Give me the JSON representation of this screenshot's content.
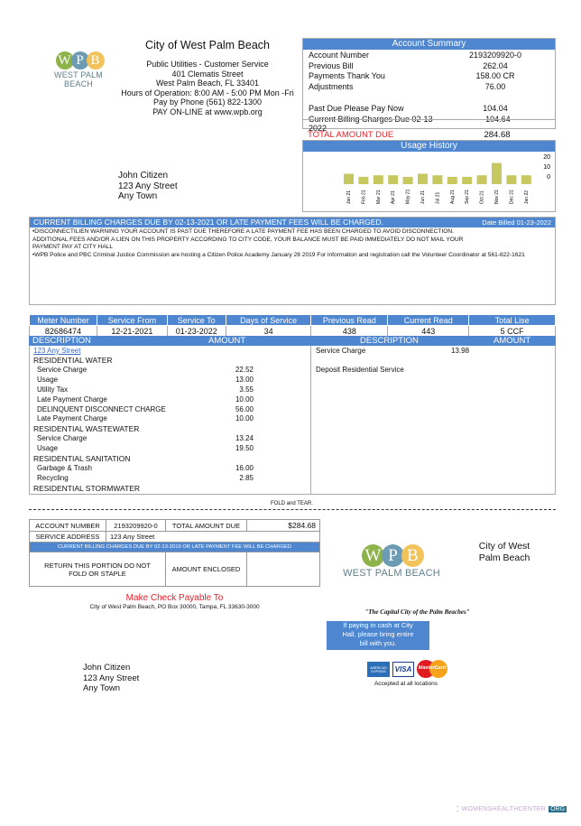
{
  "header": {
    "logo_letters": [
      "W",
      "P",
      "B"
    ],
    "logo_text": "WEST PALM BEACH",
    "title": "City of West Palm Beach",
    "lines": [
      "Public Utilities - Customer Service",
      "401 Clematis Street",
      "West Palm Beach, FL 33401",
      "Hours of Operation: 8:00 AM - 5:00 PM Mon -Fri",
      "Pay by Phone (561) 822-1300",
      "PAY ON-LINE at www.wpb.org"
    ]
  },
  "summary": {
    "title": "Account Summary",
    "rows": [
      {
        "label": "Account Number",
        "value": "2193209920-0"
      },
      {
        "label": "Previous Bill",
        "value": "262.04"
      },
      {
        "label": "Payments Thank You",
        "value": "158.00 CR"
      },
      {
        "label": "Adjustments",
        "value": "76.00"
      },
      {
        "label": "Past Due Please Pay Now",
        "value": "104.04"
      },
      {
        "label": "Current Billing Charges Due 02-13-2022",
        "value": "104.64"
      }
    ],
    "total_label": "TOTAL AMOUNT DUE",
    "total_value": "284.68",
    "total_color": "#e8202a"
  },
  "usage": {
    "title": "Usage History",
    "y_ticks": [
      "20",
      "10",
      "0"
    ],
    "months": [
      "Jan 21",
      "Feb 21",
      "Mar 21",
      "Apr 21",
      "May 21",
      "Jun 21",
      "Jul 21",
      "Aug 21",
      "Sep 21",
      "Oct 21",
      "Nov 21",
      "Dec 21",
      "Jan 22"
    ],
    "values": [
      5,
      3,
      4,
      4,
      3,
      5,
      4,
      3,
      3,
      4,
      12,
      4,
      4
    ],
    "bar_color": "#c8c860"
  },
  "customer": {
    "name": "John Citizen",
    "street": "123 Any Street",
    "town": "Any Town"
  },
  "notice": {
    "title": "CURRENT BILLING CHARGES DUE BY 02-13-2021 OR LATE PAYMENT FEES WILL BE CHARGED.",
    "date_billed": "Date Billed 01-23-2022",
    "messages": [
      "•DISCONNECTILIEN WARNING YOUR ACCOUNT IS PAST DUE THEREFORE A LATE PAYMENT FEE HAS BEEN CHARGED TO AVOID DISCONNECTION. ADDITIONAL FEES AND/OR A LIEN ON THIS PROPERTY ACCORDING TO CITY CODE, YOUR BALANCE MUST BE PAID IMMEDIATELY DO NOT MAIL YOUR PAYMENT PAY AT CITY HALL",
      "•WPB Police and PBC Criminal Justice Commission are hosting a Citizen Police Academy January 28 2019 For information and registration call the Volunteer Coordinator at 561-822-1621"
    ]
  },
  "meter": {
    "headers": [
      "Meter Number",
      "Service From",
      "Service To",
      "Days of Service",
      "Previous Read",
      "Current Read",
      "Total Lise"
    ],
    "values": [
      "82686474",
      "12-21-2021",
      "01-23-2022",
      "34",
      "438",
      "443",
      "5 CCF"
    ]
  },
  "details": {
    "desc_label": "DESCRIPTION",
    "amount_label": "AMOUNT",
    "address_link": "123 Any Street",
    "left": [
      {
        "t": "h",
        "label": "RESIDENTIAL WATER"
      },
      {
        "label": "Service Charge",
        "value": "22.52"
      },
      {
        "label": "Usage",
        "value": "13.00"
      },
      {
        "label": "Utility Tax",
        "value": "3.55"
      },
      {
        "label": "Late Payment Charge",
        "value": "10.00"
      },
      {
        "label": "DELINQUENT DISCONNECT CHARGE",
        "value": "56.00"
      },
      {
        "label": "Late Payment Charge",
        "value": "10.00"
      },
      {
        "t": "h",
        "label": "RESIDENTIAL WASTEWATER"
      },
      {
        "label": "Service Charge",
        "value": "13.24"
      },
      {
        "label": "Usage",
        "value": "19.50"
      },
      {
        "t": "h",
        "label": "RESIDENTIAL SANITATION"
      },
      {
        "label": "Garbage & Trash",
        "value": "16.00"
      },
      {
        "label": "Recycling",
        "value": "2.85"
      },
      {
        "t": "h",
        "label": "RESIDENTIAL STORMWATER"
      }
    ],
    "right": [
      {
        "label": "Service Charge",
        "value": "13.98"
      },
      {
        "label": "Deposit Residential Service",
        "value": ""
      }
    ]
  },
  "fold": "FOLD and TEAR.",
  "stub": {
    "account_label": "ACCOUNT NUMBER",
    "account": "2193209920-0",
    "total_label": "TOTAL AMOUNT DUE",
    "total": "$284.68",
    "address_label": "SERVICE ADDRESS",
    "address": "123 Any Street",
    "notice": "CURRENT BILLING CHARGES DUE BY 02-13-2019 OR LATE PAYMENT FEE WILL BE CHARGED",
    "return_note": "RETURN THIS PORTION DO NOT FOLD OR STAPLE",
    "enclosed_label": "AMOUNT ENCLOSED",
    "enclosed_value": ""
  },
  "payable": {
    "title": "Make Check Payable To",
    "address": "City of West Palm Beach, PO Box 30000, Tampa, FL 33630-3000"
  },
  "remit": {
    "city": "City of West Palm Beach",
    "tagline": "\"The Capital City of the Palm Beaches\"",
    "cash_note": "If paying in cash at City Hall, please bring entire bill with you.",
    "cards": [
      "AMERICAN EXPRESS",
      "VISA",
      "MasterCard"
    ],
    "accepted": "Accepted at all locations"
  },
  "watermark": {
    "text": "WOMENSHEALTHCENTER",
    "badge": "ORG"
  }
}
